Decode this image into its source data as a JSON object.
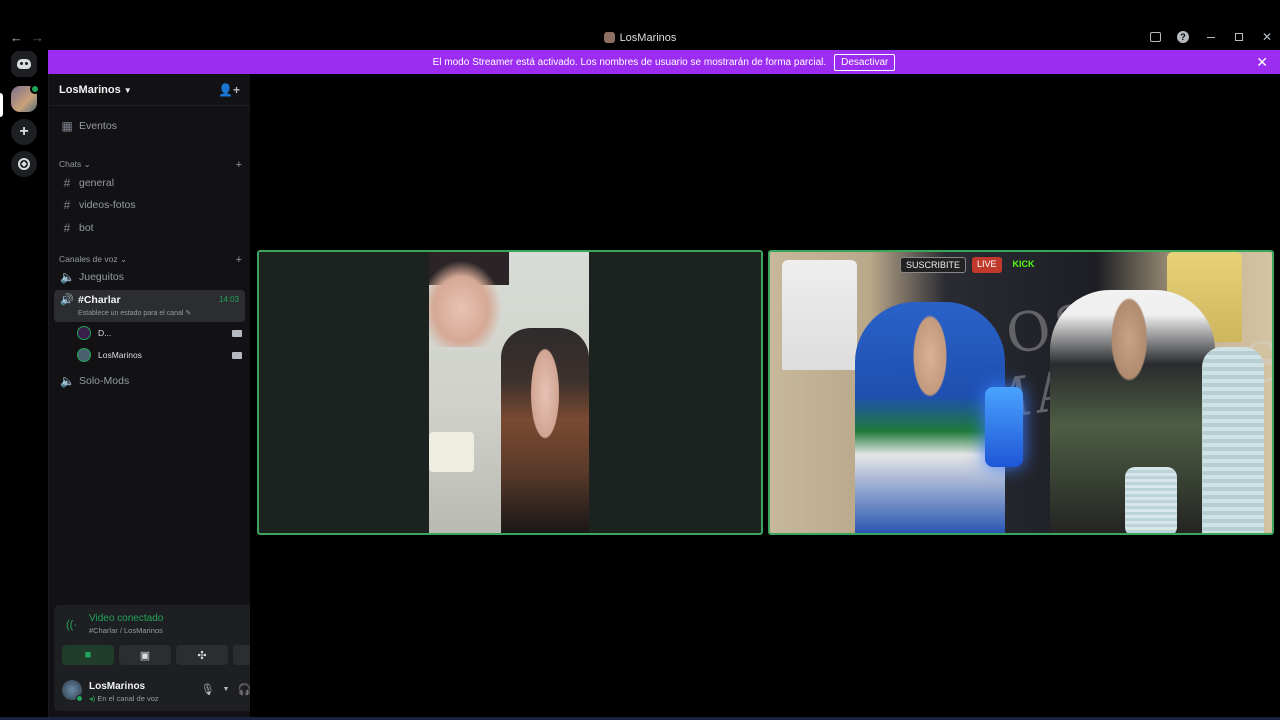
{
  "window": {
    "title": "LosMarinos",
    "back_label": "←",
    "forward_label": "→"
  },
  "banner": {
    "message": "El modo Streamer está activado. Los nombres de usuario se mostrarán de forma parcial.",
    "button_label": "Desactivar",
    "color": "#9b2cf0"
  },
  "server": {
    "name": "LosMarinos"
  },
  "sidebar": {
    "events_label": "Eventos",
    "text_category": "Chats",
    "text_channels": [
      {
        "label": "general"
      },
      {
        "label": "videos-fotos"
      },
      {
        "label": "bot"
      }
    ],
    "voice_category": "Canales de voz",
    "voice_channels": [
      {
        "label": "Jueguitos"
      },
      {
        "label": "#Charlar",
        "time": "14:03",
        "status": "Establece un estado para el canal"
      },
      {
        "label": "Solo-Mods"
      }
    ],
    "voice_users": [
      {
        "name": "D..."
      },
      {
        "name": "LosMarinos"
      }
    ]
  },
  "voice_panel": {
    "status": "Video conectado",
    "location": "#Charlar / LosMarinos",
    "accent": "#23a55a"
  },
  "user": {
    "name": "LosMarinos",
    "status": "En el canal de voz"
  },
  "stream_overlays": {
    "subscribe": "SUSCRIBITE",
    "live": "LIVE",
    "kick": "KICK",
    "logo": "LOS MARINOS"
  }
}
